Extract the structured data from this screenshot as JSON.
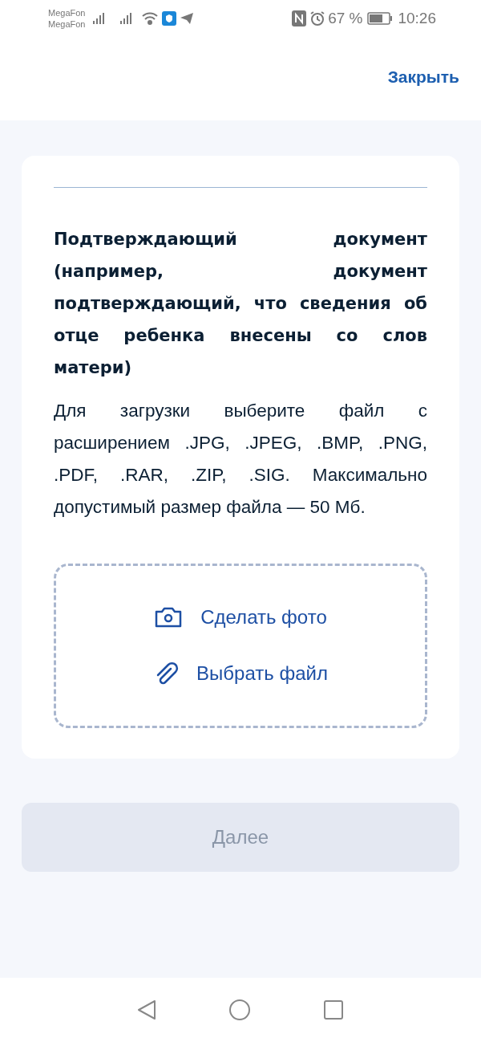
{
  "status_bar": {
    "carriers": [
      "MegaFon",
      "MegaFon"
    ],
    "battery": "67 %",
    "time": "10:26"
  },
  "header": {
    "close": "Закрыть"
  },
  "card": {
    "title": "Подтверждающий документ (например, документ подтверждающий, что сведения об отце ребенка внесены со слов матери)",
    "description": "Для загрузки выберите файл с расширением .JPG, .JPEG, .BMP, .PNG, .PDF, .RAR, .ZIP, .SIG. Максимально допустимый размер файла — 50 Мб.",
    "upload_actions": [
      {
        "kind": "camera",
        "label": "Сделать фото"
      },
      {
        "kind": "attach",
        "label": "Выбрать файл"
      }
    ]
  },
  "next_button": {
    "label": "Далее",
    "disabled": true
  }
}
